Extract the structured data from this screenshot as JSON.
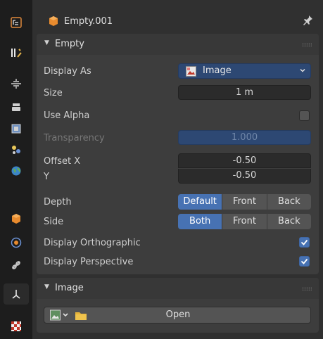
{
  "header": {
    "object_name": "Empty.001"
  },
  "tabs": [
    {
      "icon": "tool-icon"
    },
    {
      "icon": "wrench-icon"
    },
    {
      "icon": "render-icon"
    },
    {
      "icon": "output-icon"
    },
    {
      "icon": "view-layer-icon"
    },
    {
      "icon": "scene-icon"
    },
    {
      "icon": "world-icon"
    },
    {
      "icon": "object-icon"
    },
    {
      "icon": "physics-icon"
    },
    {
      "icon": "constraint-icon"
    },
    {
      "icon": "empty-data-icon"
    },
    {
      "icon": "texture-icon"
    }
  ],
  "empty_panel": {
    "title": "Empty",
    "display_as_label": "Display As",
    "display_as_value": "Image",
    "size_label": "Size",
    "size_value": "1 m",
    "use_alpha_label": "Use Alpha",
    "use_alpha_checked": false,
    "transparency_label": "Transparency",
    "transparency_value": "1.000",
    "offset_x_label": "Offset X",
    "offset_x_value": "-0.50",
    "offset_y_label": "Y",
    "offset_y_value": "-0.50",
    "depth_label": "Depth",
    "depth_options": [
      "Default",
      "Front",
      "Back"
    ],
    "depth_selected": "Default",
    "side_label": "Side",
    "side_options": [
      "Both",
      "Front",
      "Back"
    ],
    "side_selected": "Both",
    "display_ortho_label": "Display Orthographic",
    "display_ortho_checked": true,
    "display_persp_label": "Display Perspective",
    "display_persp_checked": true
  },
  "image_panel": {
    "title": "Image",
    "open_label": "Open"
  },
  "colors": {
    "accent": "#4772b3",
    "background": "#303030",
    "panel": "#3d3d3d"
  }
}
